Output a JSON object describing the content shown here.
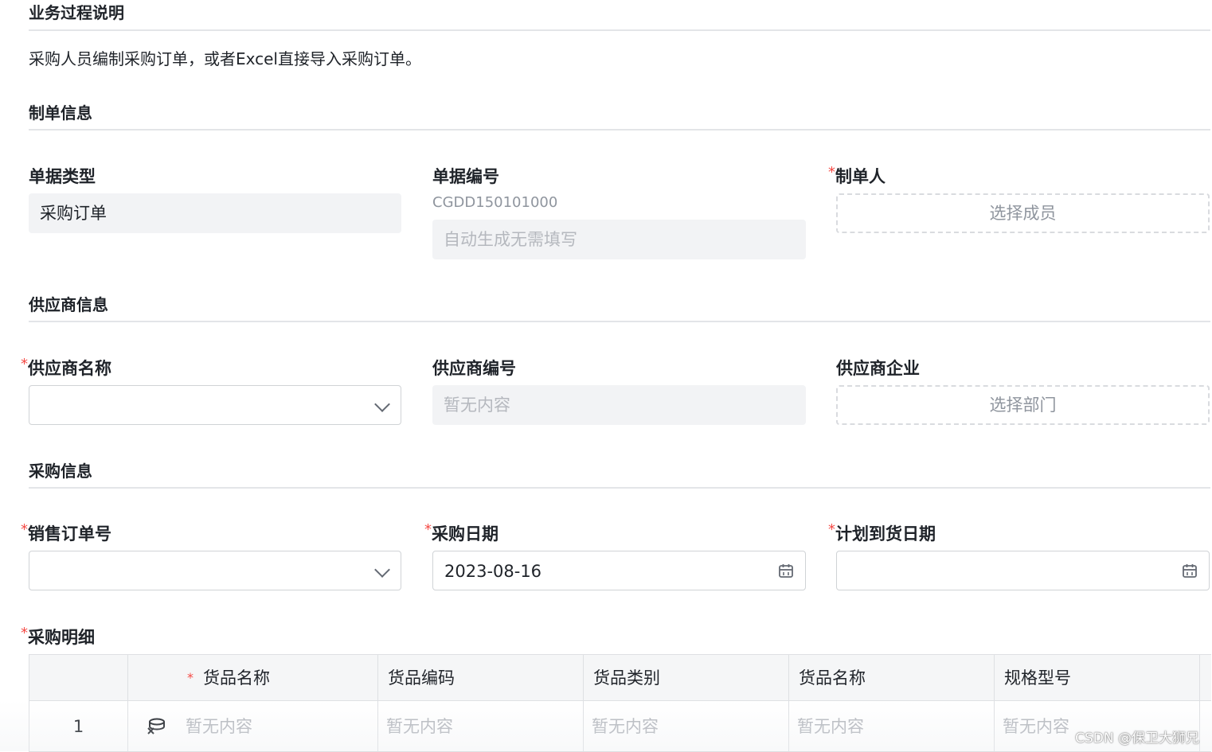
{
  "sections": {
    "process_title": "业务过程说明",
    "process_desc": "采购人员编制采购订单，或者Excel直接导入采购订单。",
    "order_info_title": "制单信息",
    "supplier_info_title": "供应商信息",
    "purchase_info_title": "采购信息"
  },
  "order_info": {
    "doc_type_label": "单据类型",
    "doc_type_value": "采购订单",
    "doc_no_label": "单据编号",
    "doc_no_hint": "CGDD150101000",
    "doc_no_placeholder": "自动生成无需填写",
    "creator_required": "*",
    "creator_label": "制单人",
    "creator_button": "选择成员"
  },
  "supplier_info": {
    "name_required": "*",
    "name_label": "供应商名称",
    "code_label": "供应商编号",
    "code_placeholder": "暂无内容",
    "company_label": "供应商企业",
    "company_button": "选择部门"
  },
  "purchase_info": {
    "sales_order_required": "*",
    "sales_order_label": "销售订单号",
    "purchase_date_required": "*",
    "purchase_date_label": "采购日期",
    "purchase_date_value": "2023-08-16",
    "arrival_date_required": "*",
    "arrival_date_label": "计划到货日期"
  },
  "detail": {
    "required": "*",
    "label": "采购明细",
    "columns": [
      {
        "label": ""
      },
      {
        "required": "*",
        "label": "货品名称"
      },
      {
        "label": "货品编码"
      },
      {
        "label": "货品类别"
      },
      {
        "label": "货品名称"
      },
      {
        "label": "规格型号"
      }
    ],
    "rows": [
      {
        "index": "1",
        "cells": [
          "暂无内容",
          "暂无内容",
          "暂无内容",
          "暂无内容",
          "暂无内容"
        ]
      }
    ]
  },
  "watermark": "CSDN @保卫大狮兄"
}
